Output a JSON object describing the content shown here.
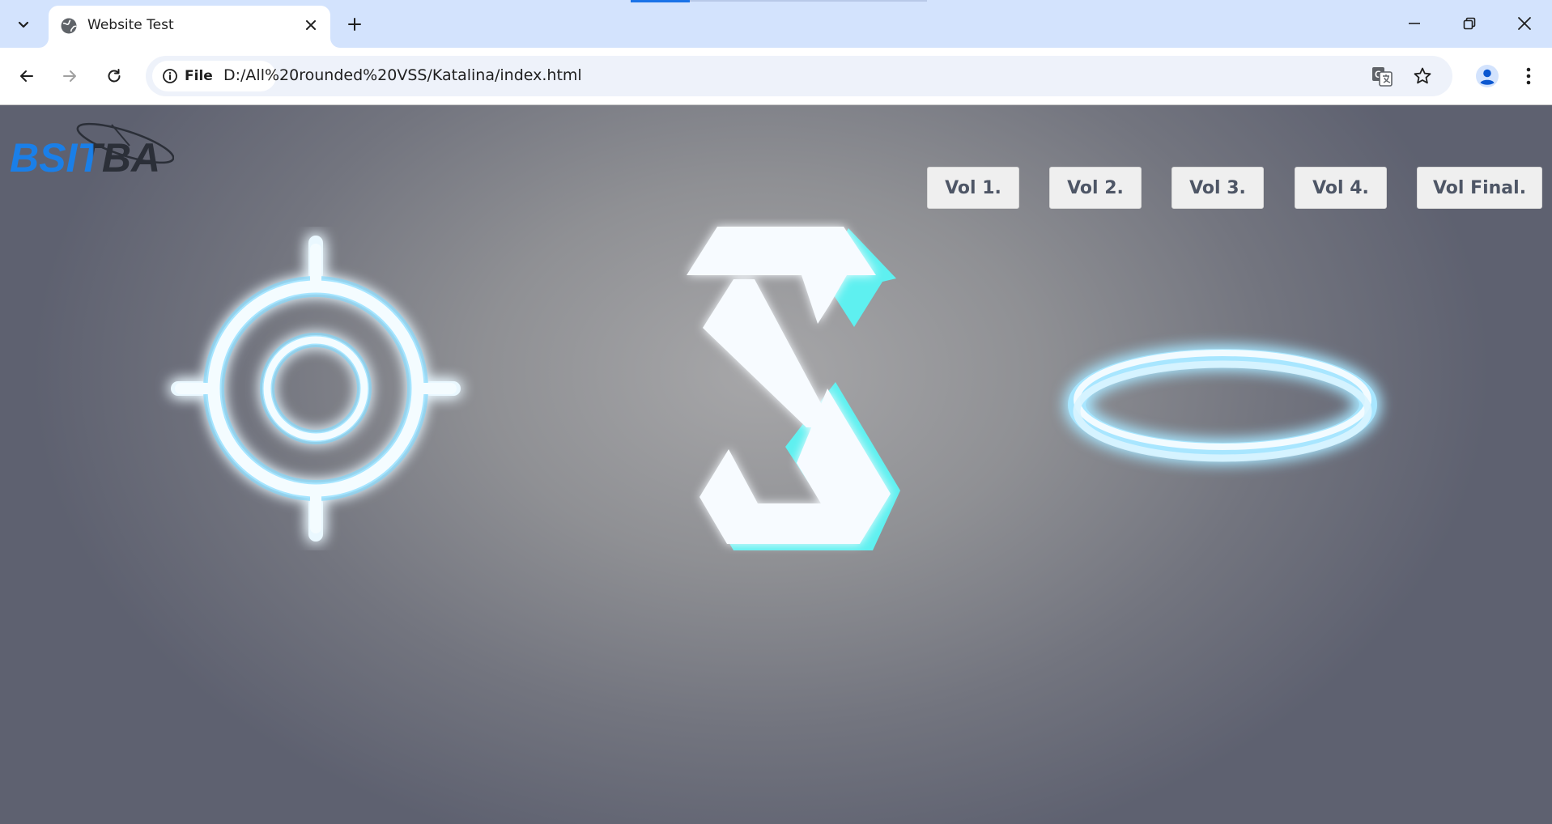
{
  "browser": {
    "tab": {
      "title": "Website Test"
    },
    "address_bar": {
      "scheme_label": "File",
      "url": "D:/All%20rounded%20VSS/Katalina/index.html"
    },
    "icons": {
      "tab_search": "chevron-down-icon",
      "favicon": "globe-icon",
      "close_tab": "close-icon",
      "new_tab": "plus-icon",
      "minimize": "minimize-icon",
      "restore": "restore-icon",
      "close_window": "close-icon",
      "back": "back-arrow-icon",
      "forward": "forward-arrow-icon",
      "reload": "reload-icon",
      "site_info": "info-icon",
      "translate": "translate-icon",
      "bookmark": "star-icon",
      "profile": "profile-icon",
      "menu": "kebab-menu-icon"
    }
  },
  "page": {
    "logo_text": "BSITBA",
    "nav_buttons": [
      "Vol 1.",
      "Vol 2.",
      "Vol 3.",
      "Vol 4.",
      "Vol Final."
    ],
    "colors": {
      "logo_blue": "#1a7fe8",
      "logo_dark": "#2b2f38",
      "glow": "#6fd6ff",
      "accent_cyan": "#5ef0f0",
      "button_bg": "#efefef",
      "button_text": "#4e5666"
    }
  }
}
